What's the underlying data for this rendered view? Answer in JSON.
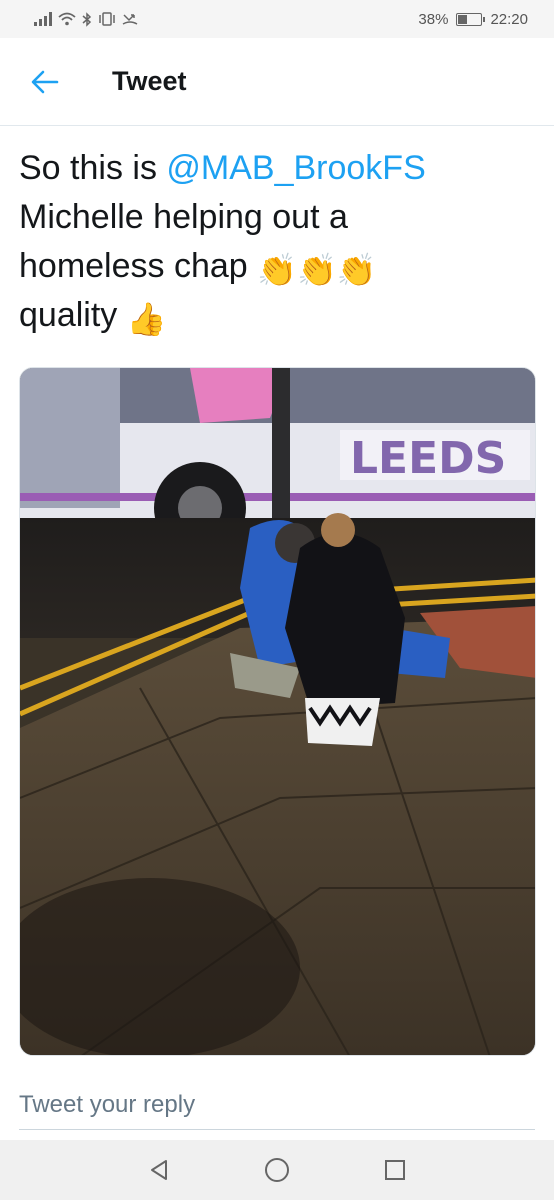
{
  "status_bar": {
    "battery_percent": "38%",
    "battery_level": 0.38,
    "time": "22:20",
    "icons": [
      "signal-icon",
      "wifi-icon",
      "bluetooth-icon",
      "vibrate-icon",
      "missed-call-icon",
      "battery-icon"
    ]
  },
  "header": {
    "title": "Tweet",
    "back_icon": "arrow-left-icon"
  },
  "tweet": {
    "text_prefix": "So this is ",
    "mention": "@MAB_BrookFS",
    "text_line2": "Michelle helping out a",
    "text_line3": "homeless chap ",
    "emoji_clap": "👏👏👏",
    "text_line4": "quality ",
    "emoji_thumb": "👍",
    "photo": "photo of two people crouching on a wet pavement at night beside a bus stop"
  },
  "reply": {
    "placeholder": "Tweet your reply"
  },
  "nav_bar": {
    "buttons": [
      "back-triangle-icon",
      "home-circle-icon",
      "recents-square-icon"
    ]
  },
  "colors": {
    "accent": "#1da1f2",
    "text": "#14171a",
    "muted": "#657786"
  }
}
